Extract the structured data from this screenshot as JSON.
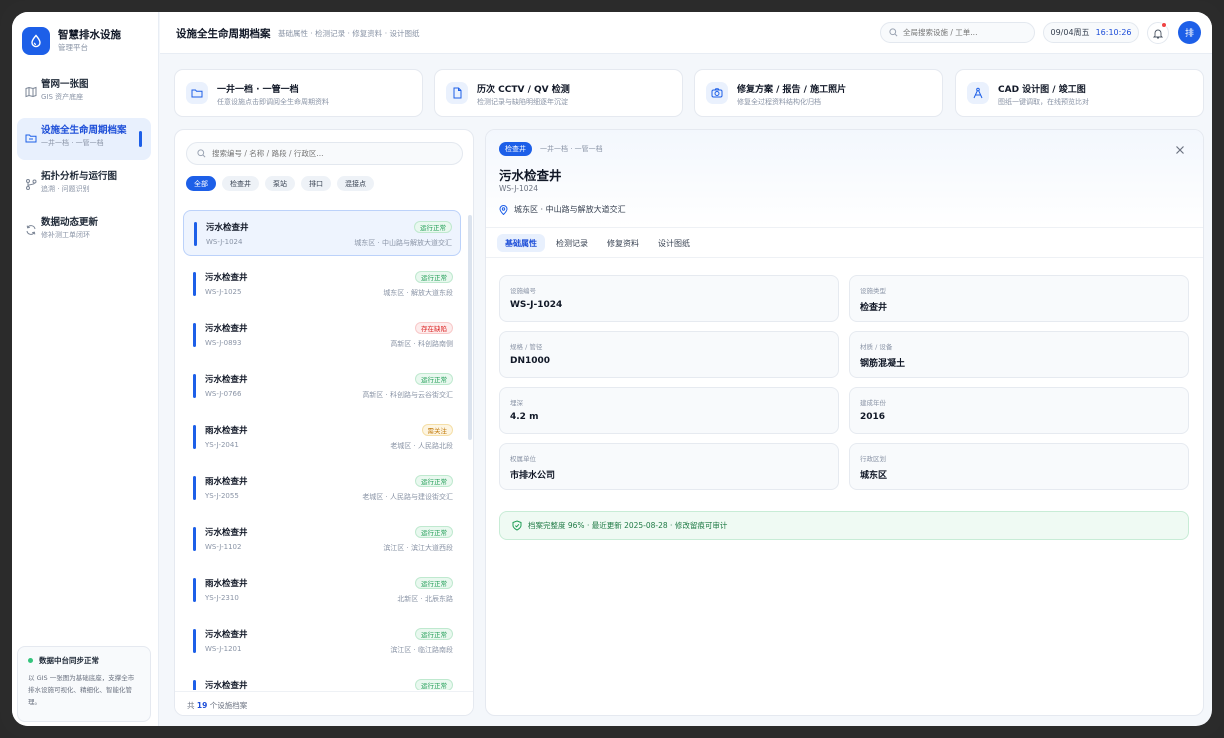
{
  "brand": {
    "title": "智慧排水设施",
    "subtitle": "管理平台"
  },
  "nav": [
    {
      "title": "管网一张图",
      "sub": "GIS 资产底座",
      "icon": "map-icon"
    },
    {
      "title": "设施全生命周期档案",
      "sub": "一井一档 · 一管一档",
      "icon": "folder-icon",
      "active": true
    },
    {
      "title": "拓扑分析与运行图",
      "sub": "追溯 · 问题识别",
      "icon": "topology-icon"
    },
    {
      "title": "数据动态更新",
      "sub": "修补测工单闭环",
      "icon": "refresh-icon"
    }
  ],
  "sync": {
    "title": "数据中台同步正常",
    "text": "以 GIS 一张图为基础底座，支撑全市排水设施可视化、精细化、智能化管理。"
  },
  "header": {
    "title": "设施全生命周期档案",
    "crumb": "基础属性 · 检测记录 · 修复资料 · 设计图纸",
    "search_placeholder": "全局搜索设施 / 工单...",
    "date": "09/04周五",
    "time": "16:10:26",
    "avatar": "排"
  },
  "features": [
    {
      "title": "一井一档 · 一管一档",
      "sub": "任意设施点击即调阅全生命周期资料",
      "icon": "folder-open-icon"
    },
    {
      "title": "历次 CCTV / QV 检测",
      "sub": "检测记录与缺陷明细逐年沉淀",
      "icon": "file-icon"
    },
    {
      "title": "修复方案 / 报告 / 施工照片",
      "sub": "修复全过程资料结构化归档",
      "icon": "camera-icon"
    },
    {
      "title": "CAD 设计图 / 竣工图",
      "sub": "图纸一键调取，在线预览比对",
      "icon": "compass-icon"
    }
  ],
  "list": {
    "search_placeholder": "搜索编号 / 名称 / 路段 / 行政区...",
    "filters": [
      "全部",
      "检查井",
      "泵站",
      "排口",
      "混接点"
    ],
    "items": [
      {
        "name": "污水检查井",
        "id": "WS-J-1024",
        "loc": "城东区 · 中山路与解放大道交汇",
        "status": "运行正常",
        "kind": "ok",
        "active": true
      },
      {
        "name": "污水检查井",
        "id": "WS-J-1025",
        "loc": "城东区 · 解放大道东段",
        "status": "运行正常",
        "kind": "ok"
      },
      {
        "name": "污水检查井",
        "id": "WS-J-0893",
        "loc": "高新区 · 科创路南侧",
        "status": "存在缺陷",
        "kind": "bad"
      },
      {
        "name": "污水检查井",
        "id": "WS-J-0766",
        "loc": "高新区 · 科创路与云谷街交汇",
        "status": "运行正常",
        "kind": "ok"
      },
      {
        "name": "雨水检查井",
        "id": "YS-J-2041",
        "loc": "老城区 · 人民路北段",
        "status": "需关注",
        "kind": "warn"
      },
      {
        "name": "雨水检查井",
        "id": "YS-J-2055",
        "loc": "老城区 · 人民路与建设街交汇",
        "status": "运行正常",
        "kind": "ok"
      },
      {
        "name": "污水检查井",
        "id": "WS-J-1102",
        "loc": "滨江区 · 滨江大道西段",
        "status": "运行正常",
        "kind": "ok"
      },
      {
        "name": "雨水检查井",
        "id": "YS-J-2310",
        "loc": "北新区 · 北辰东路",
        "status": "运行正常",
        "kind": "ok"
      },
      {
        "name": "污水检查井",
        "id": "WS-J-1201",
        "loc": "滨江区 · 临江路南段",
        "status": "运行正常",
        "kind": "ok"
      },
      {
        "name": "污水检查井",
        "id": "",
        "loc": "",
        "status": "运行正常",
        "kind": "ok"
      }
    ],
    "footer_prefix": "共",
    "footer_count": "19",
    "footer_suffix": "个设施档案"
  },
  "detail": {
    "type_badge": "检查井",
    "crumb": "一井一档 · 一管一档",
    "title": "污水检查井",
    "id": "WS-J-1024",
    "location": "城东区 · 中山路与解放大道交汇",
    "tabs": [
      "基础属性",
      "检测记录",
      "修复资料",
      "设计图纸"
    ],
    "fields": [
      {
        "label": "设施编号",
        "value": "WS-J-1024"
      },
      {
        "label": "设施类型",
        "value": "检查井"
      },
      {
        "label": "规格 / 管径",
        "value": "DN1000"
      },
      {
        "label": "材质 / 设备",
        "value": "钢筋混凝土"
      },
      {
        "label": "埋深",
        "value": "4.2 m"
      },
      {
        "label": "建成年份",
        "value": "2016"
      },
      {
        "label": "权属单位",
        "value": "市排水公司"
      },
      {
        "label": "行政区划",
        "value": "城东区"
      }
    ],
    "completeness": "档案完整度 96% · 最近更新 2025-08-28 · 修改留痕可审计"
  },
  "colors": {
    "accent": "#1d5fe8",
    "ok": "#1f9d55",
    "bad": "#dc2626",
    "warn": "#c27c0e"
  }
}
